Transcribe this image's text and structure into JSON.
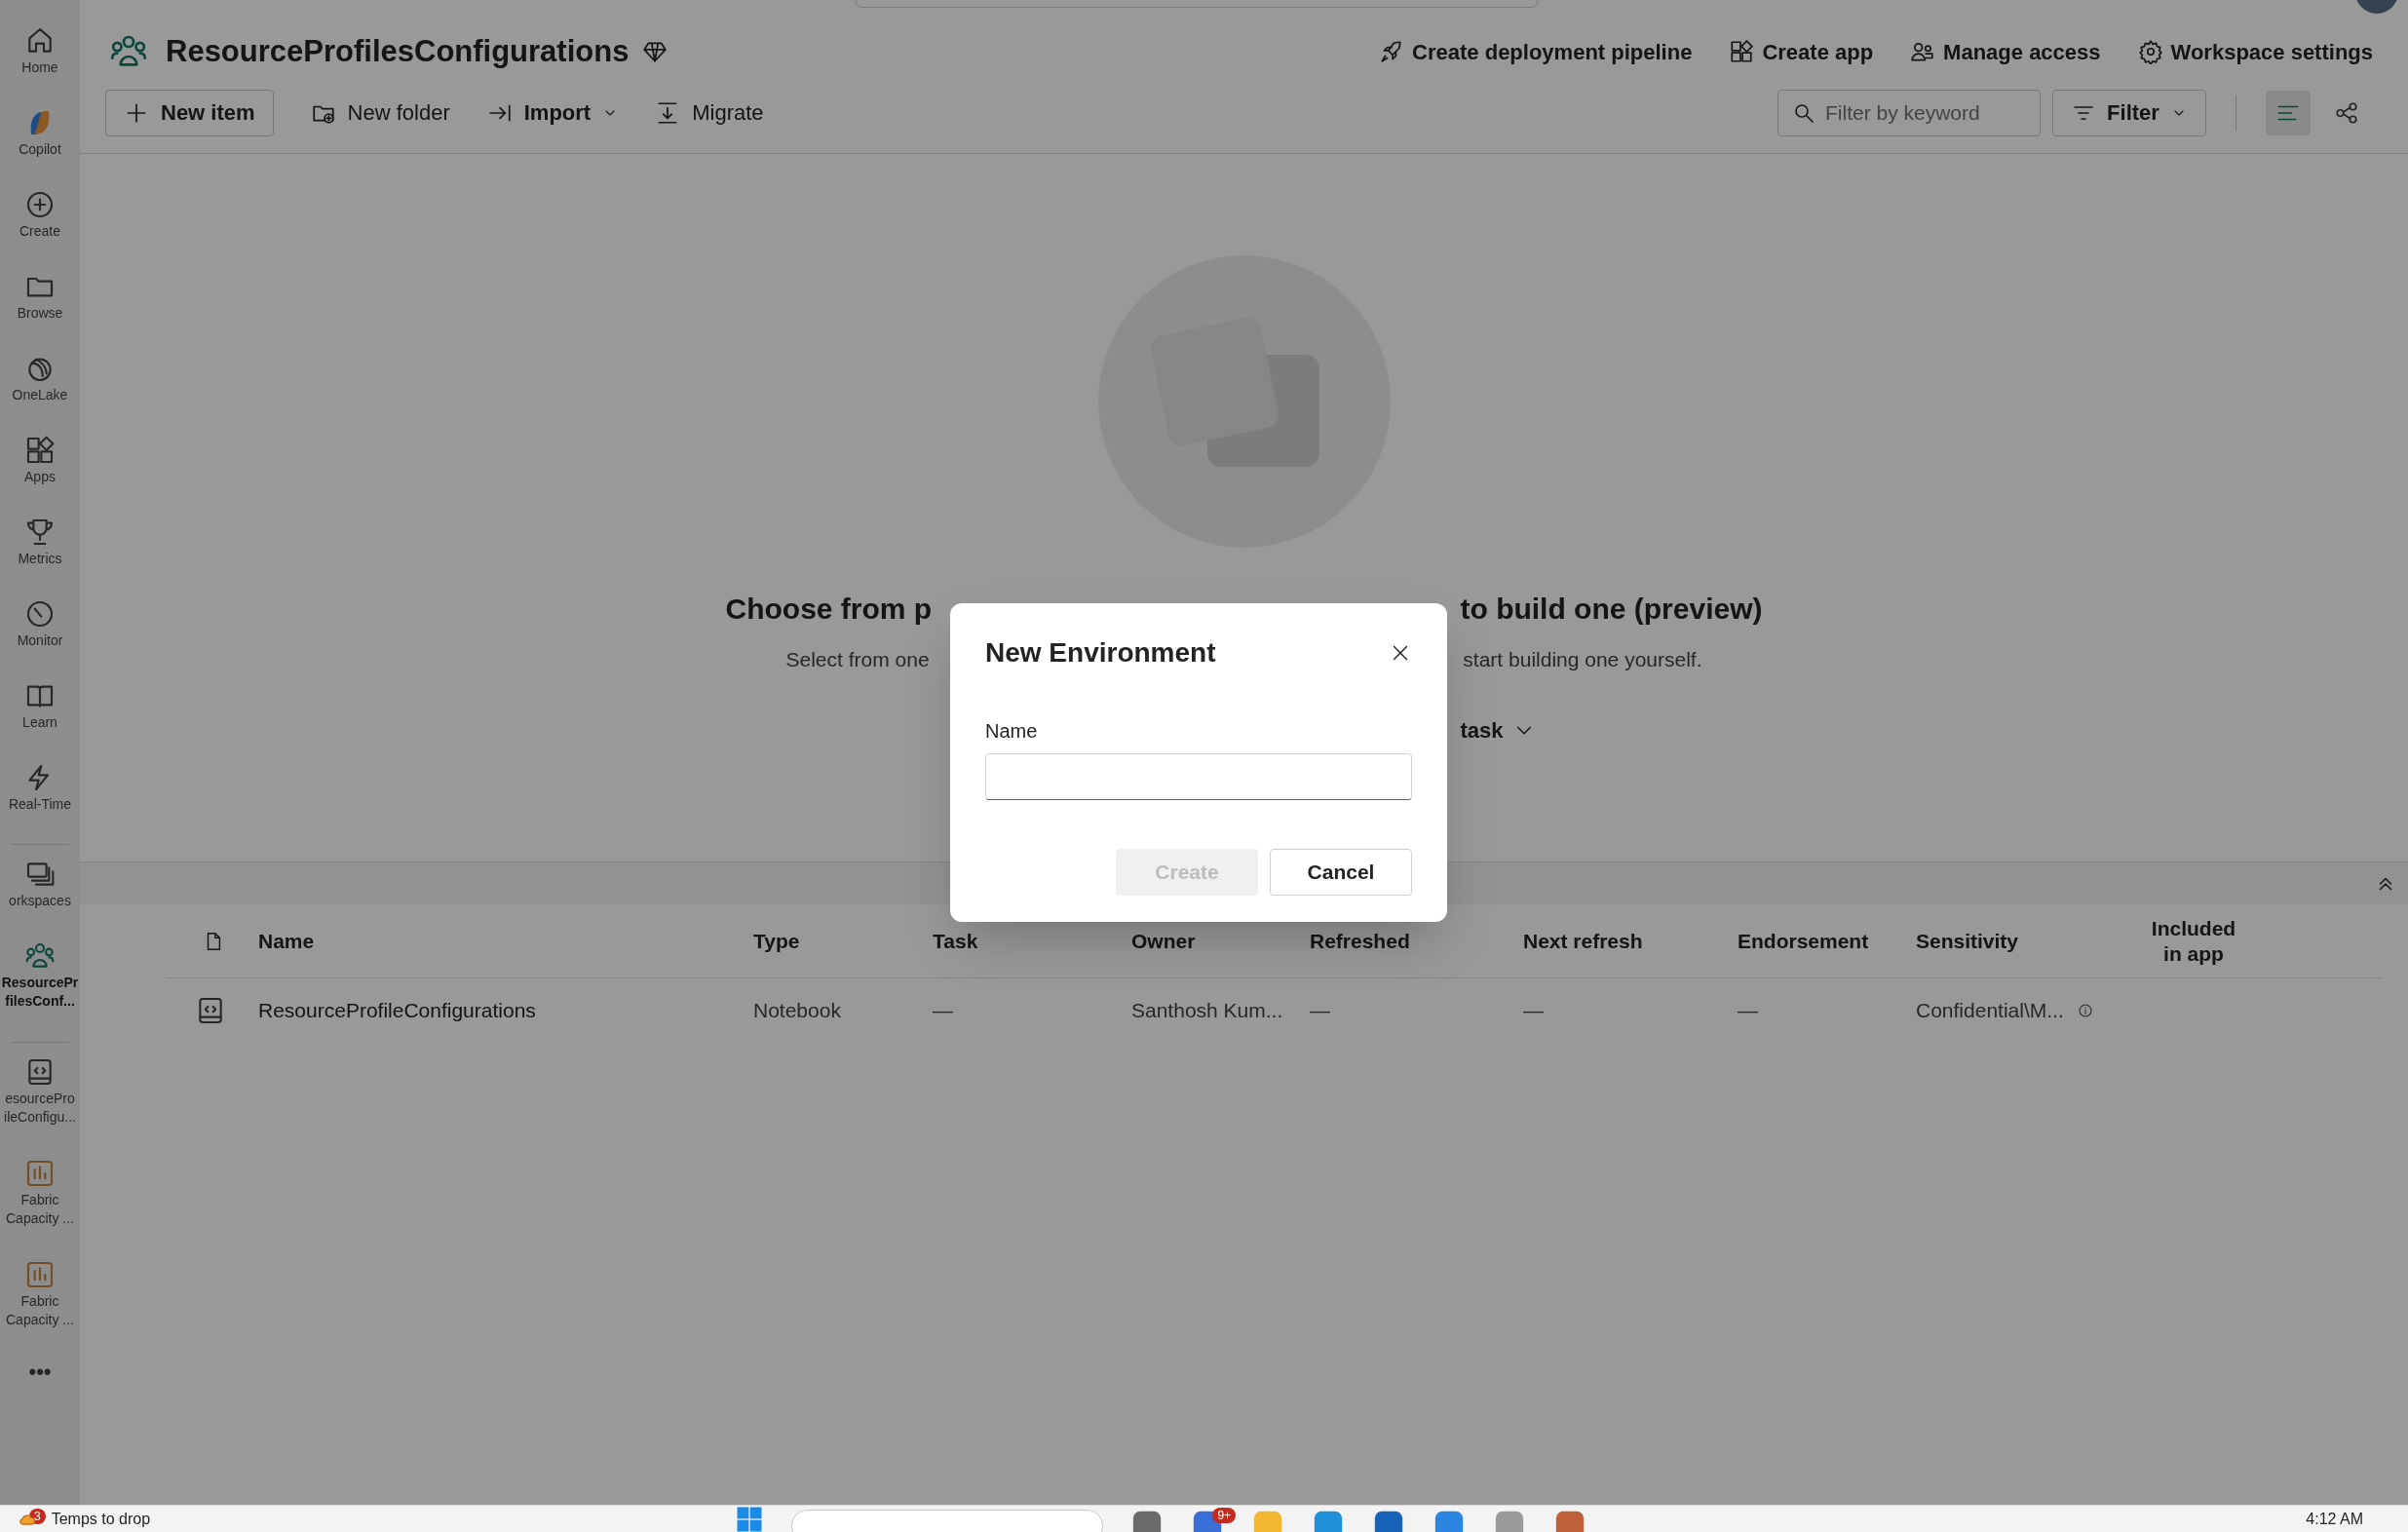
{
  "sidebar": {
    "items": [
      {
        "label": "Home",
        "selected": false
      },
      {
        "label": "Copilot",
        "selected": false
      },
      {
        "label": "Create",
        "selected": false
      },
      {
        "label": "Browse",
        "selected": false
      },
      {
        "label": "OneLake",
        "selected": false
      },
      {
        "label": "Apps",
        "selected": false
      },
      {
        "label": "Metrics",
        "selected": false
      },
      {
        "label": "Monitor",
        "selected": false
      },
      {
        "label": "Learn",
        "selected": false
      },
      {
        "label": "Real-Time",
        "selected": false
      },
      {
        "label": "orkspaces",
        "selected": false
      },
      {
        "label": "ResourcePr\nfilesConf...",
        "selected": true
      },
      {
        "label": "esourcePro\nileConfigu...",
        "selected": false
      },
      {
        "label": "Fabric\nCapacity ...",
        "selected": false
      },
      {
        "label": "Fabric\nCapacity ...",
        "selected": false
      },
      {
        "label": "•••",
        "selected": false
      }
    ]
  },
  "workspace": {
    "title": "ResourceProfilesConfigurations"
  },
  "header_actions": [
    "Create deployment pipeline",
    "Create app",
    "Manage access",
    "Workspace settings"
  ],
  "toolbar": [
    {
      "label": "New item",
      "kind": "primary"
    },
    {
      "label": "New folder",
      "kind": "plain"
    },
    {
      "label": "Import",
      "kind": "dropdown"
    },
    {
      "label": "Migrate",
      "kind": "plain"
    }
  ],
  "filter": {
    "placeholder": "Filter by keyword",
    "button": "Filter"
  },
  "view_toggle": [
    {
      "selected": true
    },
    {
      "selected": false
    }
  ],
  "empty_state": {
    "heading_start": "Choose from p",
    "heading_end": "to build one (preview)",
    "text_start": "Select from one",
    "text_end": "start building one yourself.",
    "button_end": "task"
  },
  "table": {
    "columns": [
      "Name",
      "Type",
      "Task",
      "Owner",
      "Refreshed",
      "Next refresh",
      "Endorsement",
      "Sensitivity",
      "Included\nin app"
    ],
    "rows": [
      {
        "cells": [
          "ResourceProfileConfigurations",
          "Notebook",
          "—",
          "Santhosh Kum...",
          "—",
          "—",
          "—",
          "Confidential\\M...",
          ""
        ]
      }
    ]
  },
  "dialog": {
    "title": "New Environment",
    "field_label": "Name",
    "buttons": [
      {
        "label": "Create",
        "disabled": true
      },
      {
        "label": "Cancel",
        "disabled": false
      }
    ]
  },
  "taskbar": {
    "weather_badge": "3",
    "weather_text": "Temps to drop",
    "app_badge": "9+",
    "time": "4:12 AM"
  }
}
